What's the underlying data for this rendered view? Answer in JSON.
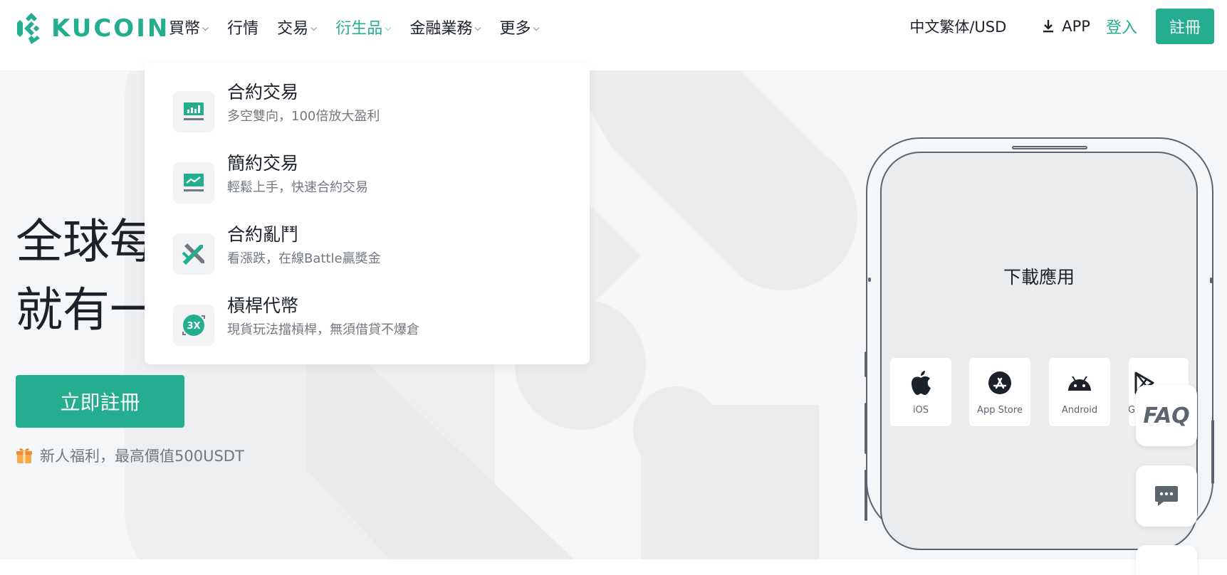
{
  "brand": {
    "name": "KUCOIN",
    "accent": "#24ae8f"
  },
  "nav": {
    "items": [
      {
        "label": "買幣",
        "has_menu": true
      },
      {
        "label": "行情",
        "has_menu": false
      },
      {
        "label": "交易",
        "has_menu": true
      },
      {
        "label": "衍生品",
        "has_menu": true,
        "active": true
      },
      {
        "label": "金融業務",
        "has_menu": true
      },
      {
        "label": "更多",
        "has_menu": true
      }
    ],
    "chevron": "⌵"
  },
  "header_right": {
    "language": "中文繁体/USD",
    "app_label": "APP",
    "login": "登入",
    "register": "註冊"
  },
  "dropdown": {
    "items": [
      {
        "title": "合約交易",
        "subtitle": "多空雙向，100倍放大盈利",
        "icon": "futures-chart-icon"
      },
      {
        "title": "簡約交易",
        "subtitle": "輕鬆上手，快速合約交易",
        "icon": "trend-line-icon"
      },
      {
        "title": "合約亂鬥",
        "subtitle": "看漲跌，在線Battle贏獎金",
        "icon": "crossed-swords-icon"
      },
      {
        "title": "槓桿代幣",
        "subtitle": "現貨玩法擋槓桿，無須借貸不爆倉",
        "icon": "leverage-3x-icon"
      }
    ]
  },
  "hero": {
    "title_line1": "全球每",
    "title_line2": "就有一",
    "cta": "立即註冊",
    "bonus_text": "新人福利，最高價值500USDT"
  },
  "phone": {
    "title": "下載應用",
    "stores": [
      {
        "label": "iOS",
        "icon": "apple-icon"
      },
      {
        "label": "App Store",
        "icon": "app-store-icon"
      },
      {
        "label": "Android",
        "icon": "android-icon"
      },
      {
        "label": "G",
        "icon": "google-play-icon"
      }
    ]
  },
  "widgets": {
    "faq": "FAQ"
  }
}
